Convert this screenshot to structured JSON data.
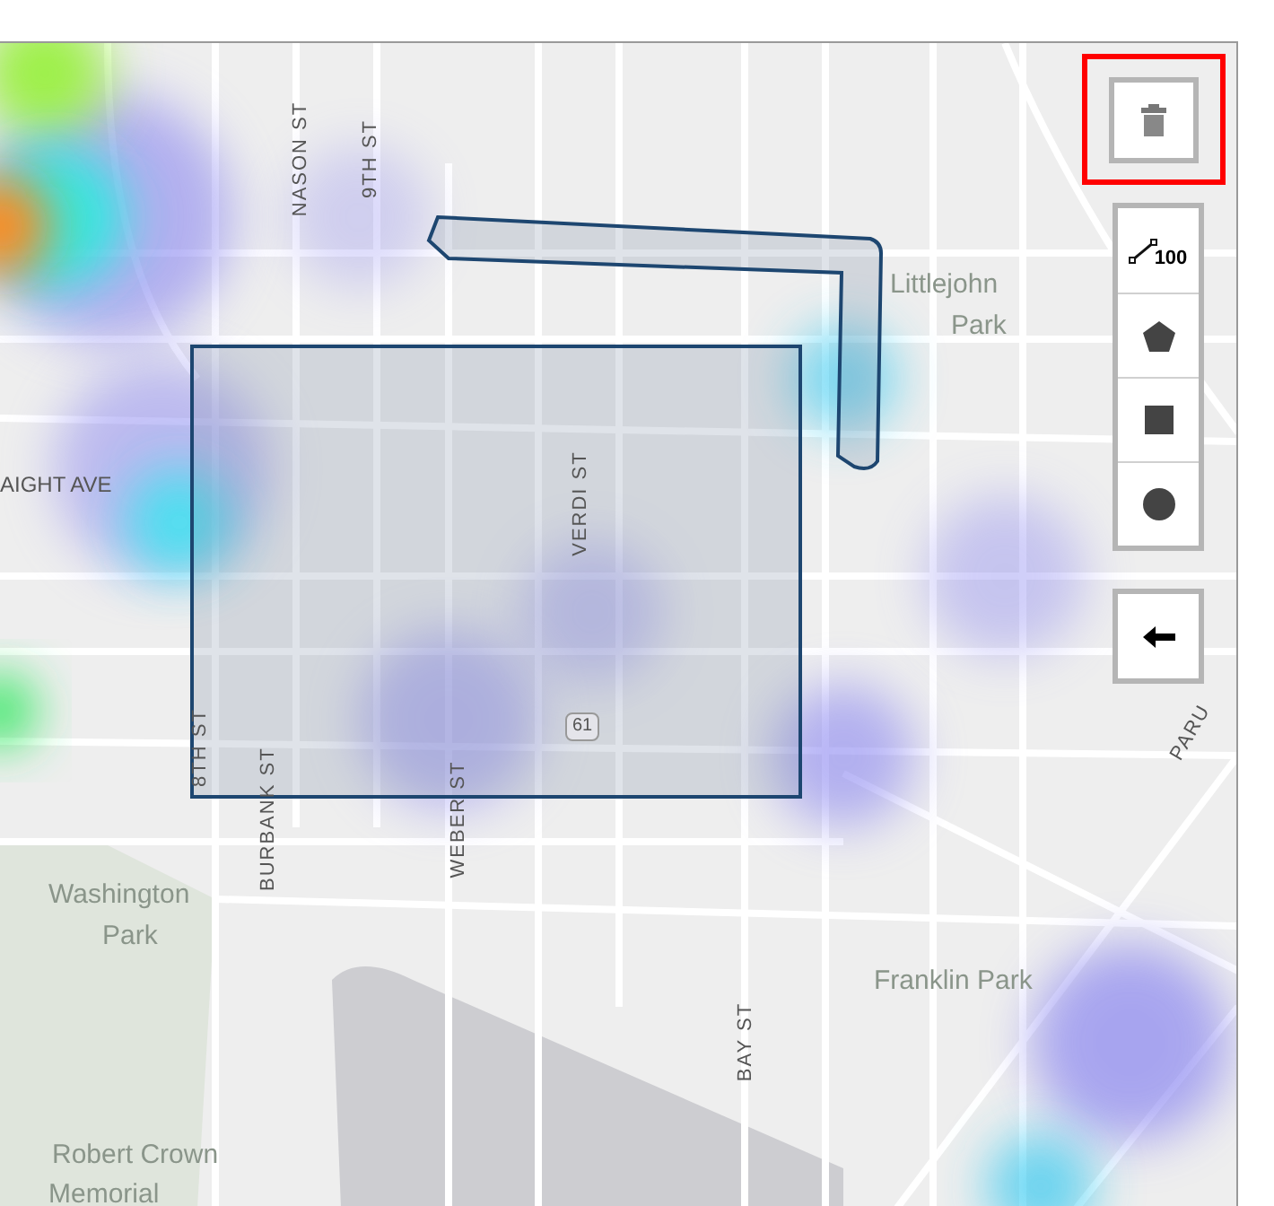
{
  "map": {
    "labels": [
      {
        "text": "NASON ST",
        "kind": "vertical"
      },
      {
        "text": "9TH ST",
        "kind": "vertical"
      },
      {
        "text": "Littlejohn",
        "kind": "park"
      },
      {
        "text": "Park",
        "kind": "park"
      },
      {
        "text": "AIGHT AVE",
        "kind": "street"
      },
      {
        "text": "VERDI ST",
        "kind": "vertical"
      },
      {
        "text": "61",
        "kind": "shield"
      },
      {
        "text": "8TH ST",
        "kind": "vertical"
      },
      {
        "text": "BURBANK ST",
        "kind": "vertical"
      },
      {
        "text": "WEBER ST",
        "kind": "vertical"
      },
      {
        "text": "PARU",
        "kind": "diagonal"
      },
      {
        "text": "Washington",
        "kind": "park"
      },
      {
        "text": "Park",
        "kind": "park"
      },
      {
        "text": "Franklin Park",
        "kind": "park"
      },
      {
        "text": "BAY ST",
        "kind": "vertical"
      },
      {
        "text": "Robert Crown",
        "kind": "park"
      },
      {
        "text": "Memorial",
        "kind": "park"
      }
    ]
  },
  "toolbar": {
    "delete": {
      "highlighted": true
    },
    "draw_tools": [
      {
        "kind": "polyline",
        "label": "100"
      },
      {
        "kind": "polygon"
      },
      {
        "kind": "rectangle"
      },
      {
        "kind": "circle"
      }
    ],
    "back": {
      "kind": "back"
    }
  }
}
